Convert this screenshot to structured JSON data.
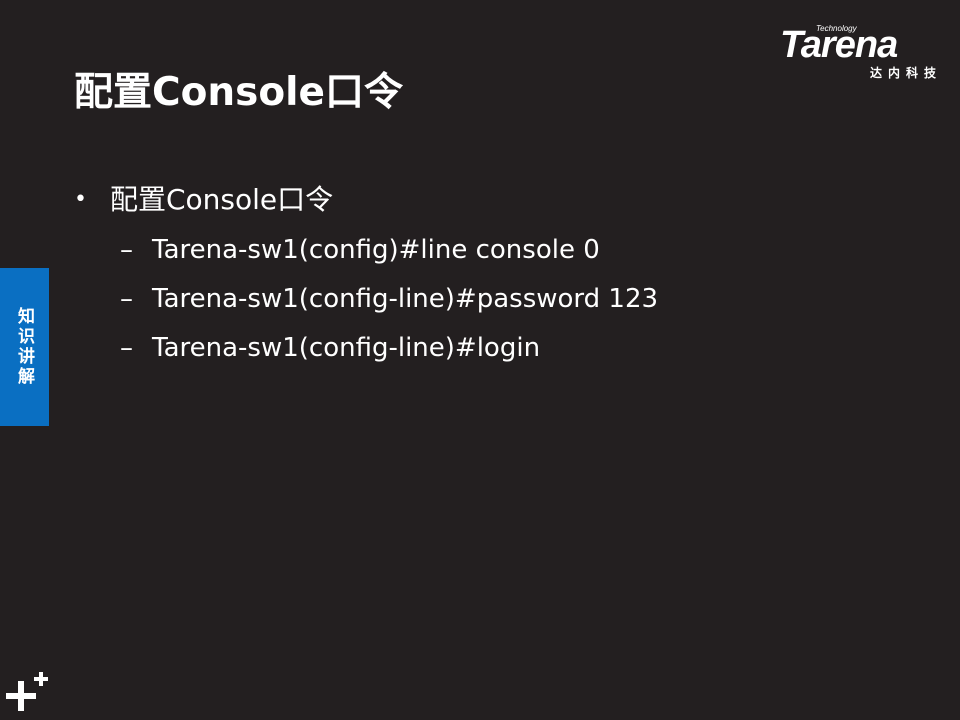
{
  "slide": {
    "title": "配置Console口令",
    "side_tab": "知识讲解"
  },
  "logo": {
    "wordmark": "Tarena",
    "tagline": "Technology",
    "cn_name": "达内科技"
  },
  "content": {
    "bullet": "配置Console口令",
    "sub_items": [
      "Tarena-sw1(config)#line console 0",
      "Tarena-sw1(config-line)#password 123",
      "Tarena-sw1(config-line)#login"
    ],
    "bullet_marker": "•",
    "sub_marker": "–"
  },
  "colors": {
    "background": "#231f20",
    "accent": "#0a6fc2",
    "text": "#ffffff"
  },
  "icons": {
    "corner_mark": "plus-icon"
  }
}
